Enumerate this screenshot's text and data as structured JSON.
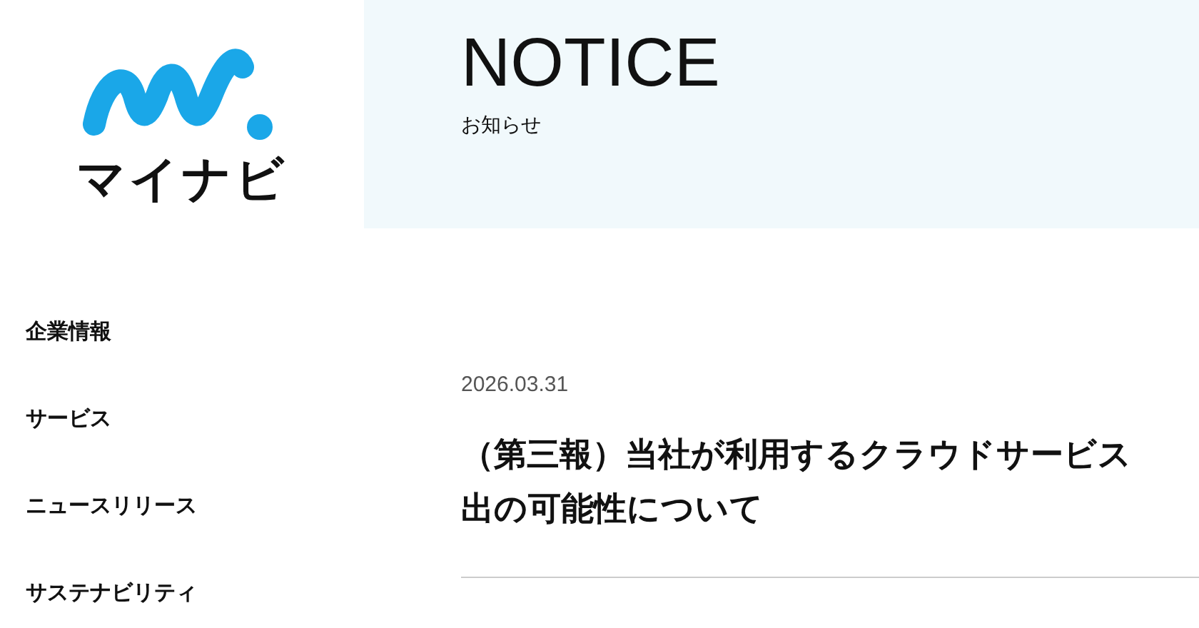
{
  "logo": {
    "text": "マイナビ"
  },
  "header": {
    "title": "NOTICE",
    "subtitle": "お知らせ"
  },
  "nav": [
    {
      "label": "企業情報"
    },
    {
      "label": "サービス"
    },
    {
      "label": "ニュースリリース"
    },
    {
      "label": "サステナビリティ"
    }
  ],
  "article": {
    "date": "2026.03.31",
    "title_lines": [
      "（第三報）当社が利用するクラウドサービス",
      "出の可能性について"
    ]
  }
}
